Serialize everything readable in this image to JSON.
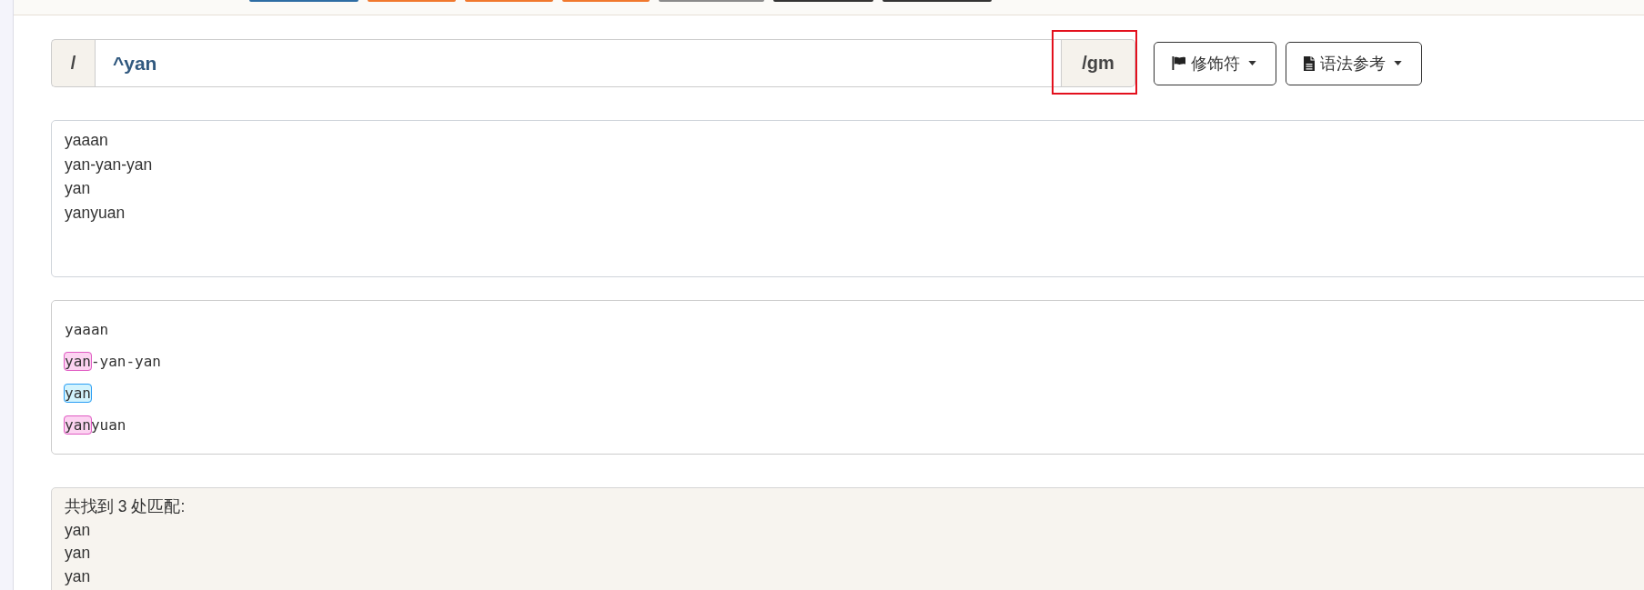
{
  "top_bar": {
    "buttons": [
      {
        "color": "#2e6da4"
      },
      {
        "color": "#f0782d"
      },
      {
        "color": "#f0782d"
      },
      {
        "color": "#f0782d"
      },
      {
        "color": "#8a8a8a"
      },
      {
        "color": "#333333"
      },
      {
        "color": "#333333"
      }
    ]
  },
  "pattern": {
    "open_delimiter": "/",
    "value": "^yan",
    "flags": "/gm",
    "flags_highlighted": true
  },
  "buttons": [
    {
      "kind": "flags",
      "label": "修饰符",
      "dropdown": true
    },
    {
      "kind": "reference",
      "label": "语法参考",
      "dropdown": true
    }
  ],
  "test_text": {
    "lines": [
      "yaaan",
      "yan-yan-yan",
      "yan",
      "yanyuan"
    ]
  },
  "preview": {
    "lines": [
      {
        "segments": [
          {
            "text": "yaaan",
            "match": false,
            "selected": false
          }
        ]
      },
      {
        "segments": [
          {
            "text": "yan",
            "match": true,
            "selected": false
          },
          {
            "text": "-yan-yan",
            "match": false,
            "selected": false
          }
        ]
      },
      {
        "segments": [
          {
            "text": "yan",
            "match": true,
            "selected": true
          }
        ]
      },
      {
        "segments": [
          {
            "text": "yan",
            "match": true,
            "selected": false
          },
          {
            "text": "yuan",
            "match": false,
            "selected": false
          }
        ]
      }
    ]
  },
  "summary": {
    "heading": "共找到 3 处匹配:",
    "matches": [
      "yan",
      "yan",
      "yan"
    ]
  }
}
